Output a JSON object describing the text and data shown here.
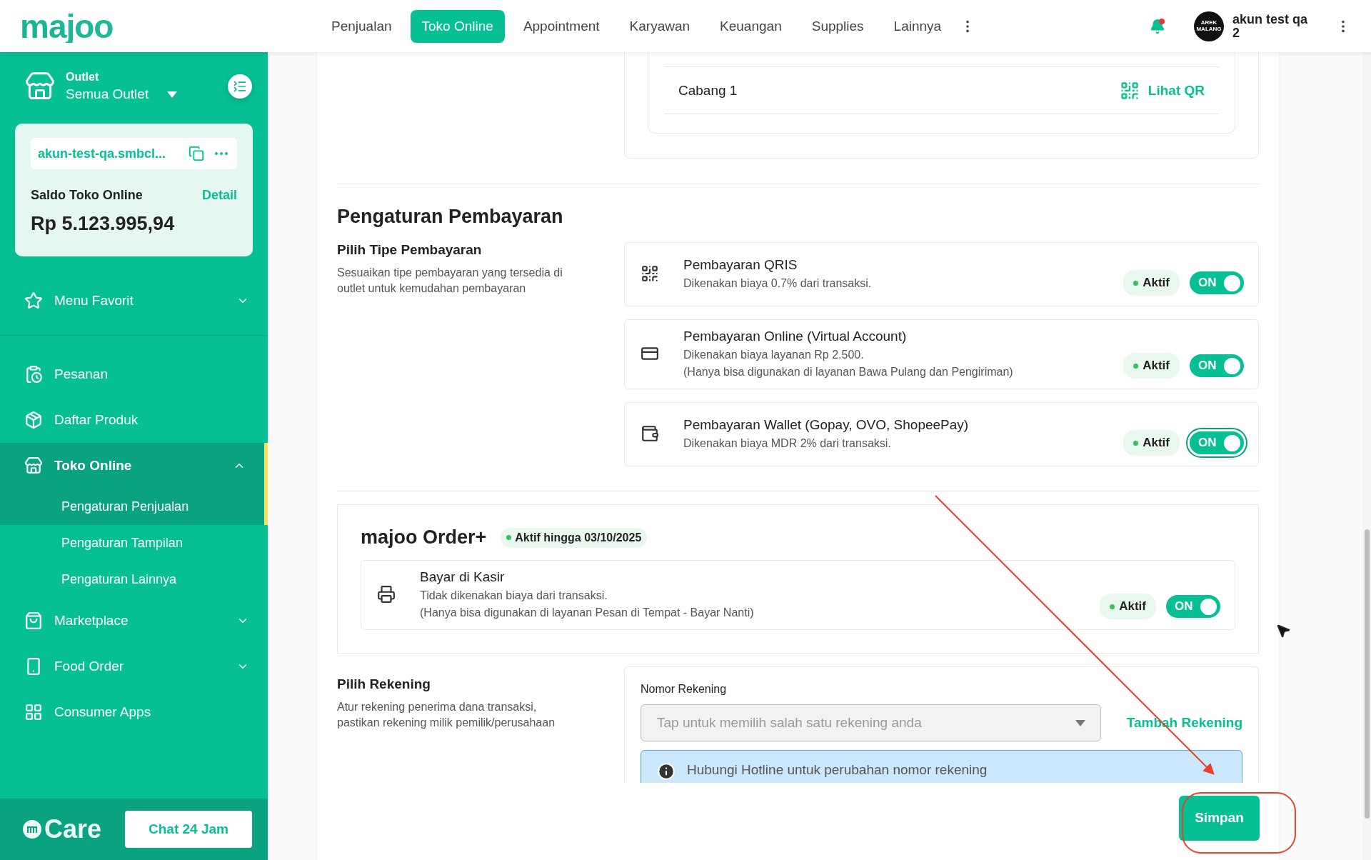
{
  "header": {
    "logo": "majoo",
    "nav": [
      {
        "label": "Penjualan",
        "selected": false
      },
      {
        "label": "Toko Online",
        "selected": true
      },
      {
        "label": "Appointment",
        "selected": false
      },
      {
        "label": "Karyawan",
        "selected": false
      },
      {
        "label": "Keuangan",
        "selected": false
      },
      {
        "label": "Supplies",
        "selected": false
      },
      {
        "label": "Lainnya",
        "selected": false
      }
    ],
    "notification_unread": true,
    "avatar_text": "AREK MALANG",
    "user_name": "akun test qa 2"
  },
  "sidebar": {
    "outlet_label": "Outlet",
    "outlet_value": "Semua Outlet",
    "store_url": "akun-test-qa.smbcl...",
    "balance_label": "Saldo Toko Online",
    "balance_link": "Detail",
    "balance": "Rp 5.123.995,94",
    "favorite": {
      "label": "Menu Favorit",
      "expanded": false
    },
    "items": [
      {
        "kind": "link",
        "label": "Pesanan",
        "selected": false
      },
      {
        "kind": "link",
        "label": "Daftar Produk",
        "selected": false
      },
      {
        "kind": "group",
        "label": "Toko Online",
        "selected": true,
        "expanded": true,
        "children": [
          {
            "label": "Pengaturan Penjualan",
            "selected": true
          },
          {
            "label": "Pengaturan Tampilan",
            "selected": false
          },
          {
            "label": "Pengaturan Lainnya",
            "selected": false
          }
        ]
      },
      {
        "kind": "group",
        "label": "Marketplace",
        "selected": false,
        "expanded": false
      },
      {
        "kind": "group",
        "label": "Food Order",
        "selected": false,
        "expanded": false
      },
      {
        "kind": "link",
        "label": "Consumer Apps",
        "selected": false
      }
    ],
    "care_logo": "Care",
    "chat_button": "Chat 24 Jam"
  },
  "outlets": [
    {
      "name": "Cabang 1",
      "action": "Lihat QR"
    }
  ],
  "payment_settings": {
    "title": "Pengaturan Pembayaran",
    "type_label": "Pilih Tipe Pembayaran",
    "type_desc": "Sesuaikan tipe pembayaran yang tersedia di outlet untuk kemudahan pembayaran",
    "methods": [
      {
        "name": "Pembayaran QRIS",
        "desc": [
          "Dikenakan biaya 0.7% dari transaksi."
        ],
        "status": "Aktif",
        "toggle": "ON",
        "on": true,
        "focused": false
      },
      {
        "name": "Pembayaran Online (Virtual Account)",
        "desc": [
          "Dikenakan biaya layanan Rp 2.500.",
          "(Hanya bisa digunakan di layanan Bawa Pulang dan Pengiriman)"
        ],
        "status": "Aktif",
        "toggle": "ON",
        "on": true,
        "focused": false
      },
      {
        "name": "Pembayaran Wallet (Gopay, OVO, ShopeePay)",
        "desc": [
          "Dikenakan biaya MDR 2% dari transaksi."
        ],
        "status": "Aktif",
        "toggle": "ON",
        "on": true,
        "focused": true
      }
    ]
  },
  "order_plus": {
    "title": "majoo Order+",
    "badge": "Aktif hingga 03/10/2025",
    "methods": [
      {
        "name": "Bayar di Kasir",
        "desc": [
          "Tidak dikenakan biaya dari transaksi.",
          "(Hanya bisa digunakan di layanan Pesan di Tempat - Bayar Nanti)"
        ],
        "status": "Aktif",
        "toggle": "ON",
        "on": true,
        "focused": false
      }
    ]
  },
  "account": {
    "label": "Pilih Rekening",
    "desc": "Atur rekening penerima dana transaksi, pastikan rekening milik pemilik/perusahaan",
    "field_label": "Nomor Rekening",
    "placeholder": "Tap untuk memilih salah satu rekening anda",
    "add_link": "Tambah Rekening",
    "info": "Hubungi Hotline untuk perubahan nomor rekening"
  },
  "save_button": "Simpan"
}
